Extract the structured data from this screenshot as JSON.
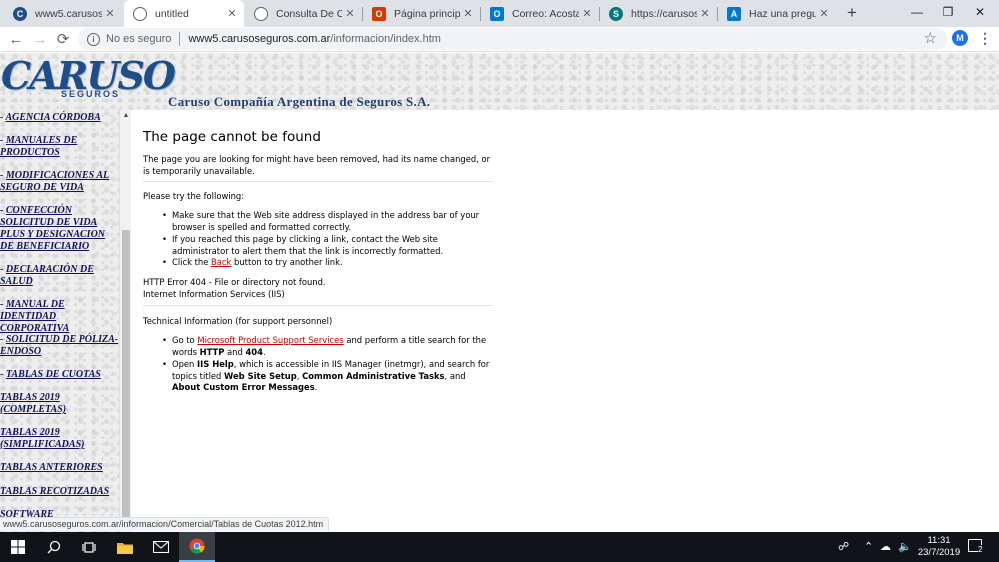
{
  "browser": {
    "tabs": [
      {
        "title": "www5.carusosegu",
        "favicon": "caruso-favicon",
        "color": "#1f4e86",
        "active": false
      },
      {
        "title": "untitled",
        "favicon": "globe-icon",
        "color": "#5f6368",
        "active": true
      },
      {
        "title": "Consulta De Cuen",
        "favicon": "globe-icon",
        "color": "#5f6368",
        "active": false
      },
      {
        "title": "Página principal d",
        "favicon": "office-icon",
        "color": "#d83b01",
        "active": false
      },
      {
        "title": "Correo: Acosta Ca",
        "favicon": "outlook-icon",
        "color": "#0078d4",
        "active": false
      },
      {
        "title": "https://carusosegu",
        "favicon": "sharepoint-icon",
        "color": "#03787c",
        "active": false
      },
      {
        "title": "Haz una pregunta",
        "favicon": "azure-icon",
        "color": "#0078d4",
        "active": false
      }
    ],
    "new_tab_glyph": "+",
    "security_label": "No es seguro",
    "url_host": "www5.carusoseguros.com.ar",
    "url_path": "/informacion/index.htm",
    "profile_initial": "M",
    "status_url": "www5.carusoseguros.com.ar/informacion/Comercial/Tablas de Cuotas 2012.htm"
  },
  "site": {
    "logo_word": "CARUSO",
    "logo_sub": "SEGUROS",
    "company_name": "Caruso Compañía Argentina de Seguros S.A.",
    "sidebar": [
      {
        "prefix": "- ",
        "label": "AGENCIA  CÓRDOBA"
      },
      {
        "prefix": "- ",
        "label": "MANUALES DE PRODUCTOS"
      },
      {
        "prefix": "- ",
        "label": "MODIFICACIONES AL SEGURO DE VIDA"
      },
      {
        "prefix": "- ",
        "label": "CONFECCIÓN SOLICITUD DE VIDA PLUS Y DESIGNACION DE BENEFICIARIO"
      },
      {
        "prefix": "- ",
        "label": "DECLARACIÓN DE SALUD"
      },
      {
        "prefix": "- ",
        "label": "MANUAL DE IDENTIDAD CORPORATIVA"
      },
      {
        "prefix": "- ",
        "label": "SOLICITUD DE PÓLIZA-ENDOSO"
      },
      {
        "prefix": "- ",
        "label": "TABLAS DE CUOTAS"
      },
      {
        "prefix": "",
        "label": "TABLAS 2019 (COMPLETAS)"
      },
      {
        "prefix": "",
        "label": "TABLAS 2019 (SIMPLIFICADAS)"
      },
      {
        "prefix": "",
        "label": "TABLAS ANTERIORES"
      },
      {
        "prefix": "",
        "label": "TABLAS RECOTIZADAS"
      },
      {
        "prefix": "",
        "label": "SOFTWARE"
      }
    ]
  },
  "error": {
    "title": "The page cannot be found",
    "intro": "The page you are looking for might have been removed, had its name changed, or is temporarily unavailable.",
    "try_heading": "Please try the following:",
    "bullet1": "Make sure that the Web site address displayed in the address bar of your browser is spelled and formatted correctly.",
    "bullet2": "If you reached this page by clicking a link, contact the Web site administrator to alert them that the link is incorrectly formatted.",
    "bullet3_pre": "Click the ",
    "bullet3_link": "Back",
    "bullet3_post": " button to try another link.",
    "http_error": "HTTP Error 404 - File or directory not found.",
    "iis": "Internet Information Services (IIS)",
    "tech_heading": "Technical Information (for support personnel)",
    "tech1_pre": "Go to ",
    "tech1_link": "Microsoft Product Support Services",
    "tech1_mid": " and perform a title search for the words ",
    "tech1_b1": "HTTP",
    "tech1_and": " and ",
    "tech1_b2": "404",
    "tech1_end": ".",
    "tech2_pre": "Open ",
    "tech2_b1": "IIS Help",
    "tech2_mid": ", which is accessible in IIS Manager (inetmgr), and search for topics titled ",
    "tech2_b2": "Web Site Setup",
    "tech2_c1": ", ",
    "tech2_b3": "Common Administrative Tasks",
    "tech2_c2": ", and ",
    "tech2_b4": "About Custom Error Messages",
    "tech2_end": "."
  },
  "taskbar": {
    "time": "11:31",
    "date": "23/7/2019",
    "notification_count": "2",
    "apps": [
      "start-icon",
      "search-icon",
      "task-view-icon",
      "file-explorer-icon",
      "mail-icon",
      "chrome-icon"
    ]
  },
  "colors": {
    "link": "#12125a",
    "error_link": "#cc0000",
    "brand": "#1f4e86"
  }
}
